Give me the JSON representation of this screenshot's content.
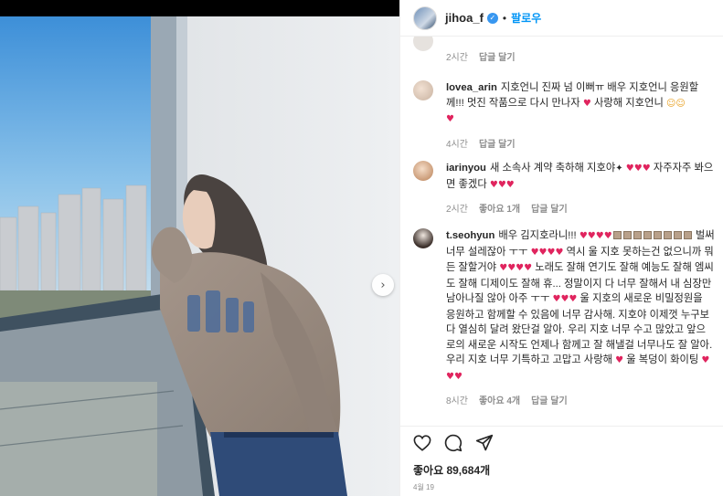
{
  "header": {
    "username": "jihoa_f",
    "follow_label": "팔로우",
    "separator": "•"
  },
  "comments": [
    {
      "user": "",
      "text": "",
      "time": "2시간",
      "reply": "답글 달기"
    },
    {
      "user": "lovea_arin",
      "text_parts": [
        "지호언니 진짜 넘 이뻐ㅠ 배우 지호언니 응원할께!!! 멋진 작품으로 다시 만나자",
        "사랑해 지호언니"
      ],
      "time": "4시간",
      "reply": "답글 달기"
    },
    {
      "user": "iarinyou",
      "text_parts": [
        "새 소속사 계약 축하해 지호야",
        "자주자주 봐으면 좋겠다"
      ],
      "time": "2시간",
      "likes": "좋아요 1개",
      "reply": "답글 달기"
    },
    {
      "user": "t.seohyun",
      "text_parts": [
        "배우 김지호라니!!!",
        "벌써 너무 설레잖아 ㅜㅜ",
        "역시 울 지호 못하는건 없으니까 뭐든 잘할거야",
        "노래도 잘해 연기도 잘해 예능도 잘해 엠씨도 잘해 디제이도 잘해 휴... 정말이지 다 너무 잘해서 내 심장만 남아나질 않아 아주 ㅜㅜ",
        "울 지호의 새로운 비밀정원을 응원하고 함께할 수 있음에 너무 감사해. 지호야 이제껏 누구보다 열심히 달려 왔단걸 알아. 우리 지호 너무 수고 많았고 앞으로의 새로운 시작도 언제나 함께고 잘 해낼걸 너무나도 잘 알아. 우리 지호 너무 기특하고 고맙고 사랑해",
        "울 복덩이 화이팅"
      ],
      "time": "8시간",
      "likes": "좋아요 4개",
      "reply": "답글 달기"
    }
  ],
  "actions": {
    "like_icon": "heart-icon",
    "comment_icon": "comment-icon",
    "share_icon": "paper-plane-icon"
  },
  "likes_count": "좋아요 89,684개",
  "post_date": "4월 19",
  "colors": {
    "accent": "#0095f6",
    "heart": "#e0245e",
    "muted": "#8e8e8e",
    "text": "#262626"
  }
}
